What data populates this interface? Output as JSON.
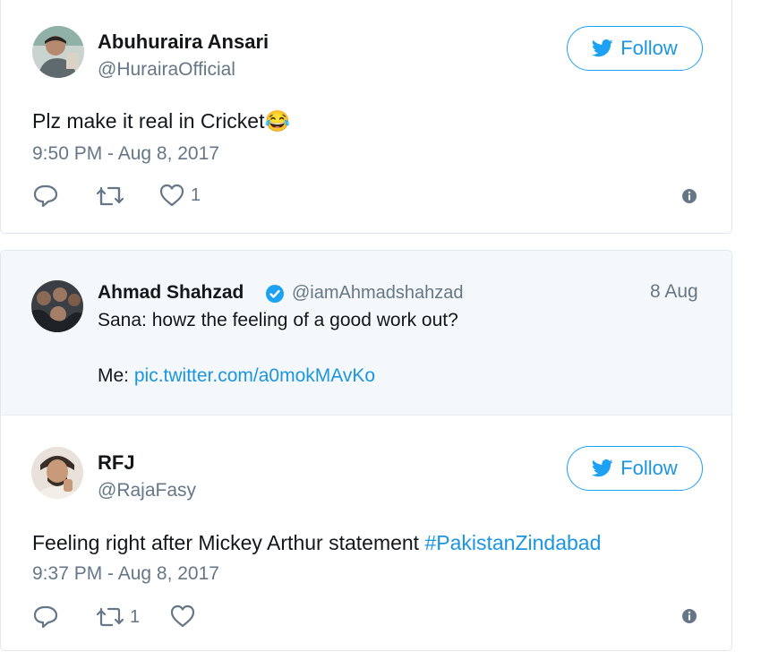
{
  "tweet1": {
    "author_name": "Abuhuraira Ansari",
    "handle": "@HurairaOfficial",
    "follow_label": "Follow",
    "text": "Plz make it real in Cricket",
    "emoji": "😂",
    "timestamp": "9:50 PM - Aug 8, 2017",
    "reply_count": "",
    "retweet_count": "",
    "like_count": "1"
  },
  "quoted_tweet": {
    "author_name": "Ahmad Shahzad",
    "handle": "@iamAhmadshahzad",
    "date": "8 Aug",
    "line1": "Sana: howz the feeling of a good work out?",
    "line2_prefix": "Me: ",
    "line2_link": "pic.twitter.com/a0mokMAvKo"
  },
  "tweet2": {
    "author_name": "RFJ",
    "handle": "@RajaFasy",
    "follow_label": "Follow",
    "text_prefix": "Feeling right after Mickey Arthur statement ",
    "hashtag": "#PakistanZindabad",
    "timestamp": "9:37 PM - Aug 8, 2017",
    "reply_count": "",
    "retweet_count": "1",
    "like_count": ""
  },
  "colors": {
    "brand_blue": "#1da1f2",
    "link_blue": "#1b95e0",
    "muted_gray": "#657786",
    "quote_bg": "#f5f8fa"
  },
  "icons": [
    "twitter-bird-icon",
    "reply-icon",
    "retweet-icon",
    "like-icon",
    "info-icon",
    "verified-icon"
  ]
}
